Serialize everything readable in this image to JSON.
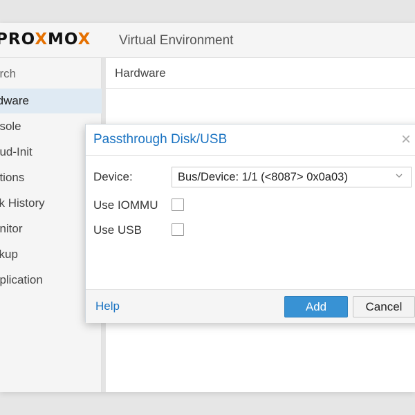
{
  "header": {
    "logo_prefix": "PRO",
    "logo_x1": "X",
    "logo_mid": "MO",
    "logo_x2": "X",
    "product_name": "Virtual Environment"
  },
  "sidebar": {
    "search_label": "arch",
    "items": [
      {
        "label": "rdware",
        "active": true
      },
      {
        "label": "nsole",
        "active": false
      },
      {
        "label": "oud-Init",
        "active": false
      },
      {
        "label": "ptions",
        "active": false
      },
      {
        "label": "sk History",
        "active": false
      },
      {
        "label": "onitor",
        "active": false
      },
      {
        "label": "ckup",
        "active": false
      },
      {
        "label": "eplication",
        "active": false
      }
    ]
  },
  "content": {
    "title": "Hardware"
  },
  "dialog": {
    "title": "Passthrough Disk/USB",
    "device_label": "Device:",
    "device_value": "Bus/Device: 1/1 (<8087> 0x0a03)",
    "iommu_label": "Use IOMMU",
    "usb_label": "Use USB",
    "help_label": "Help",
    "add_label": "Add",
    "cancel_label": "Cancel",
    "close_glyph": "×"
  },
  "icons": {
    "close": "close-icon",
    "chevron": "chevron-down-icon"
  },
  "colors": {
    "accent": "#1a73c2",
    "logo_x": "#e57000",
    "primary_button": "#3892d4",
    "sidebar_active": "#dfeaf3"
  }
}
